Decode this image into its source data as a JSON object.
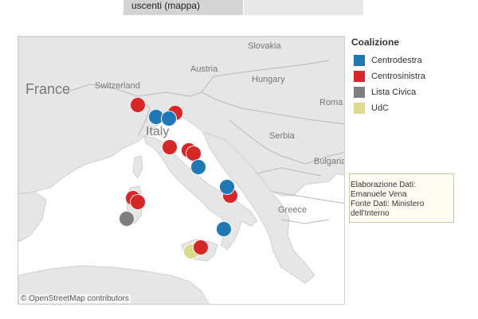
{
  "tabs": [
    {
      "label": "uscenti (mappa)",
      "active": true
    },
    {
      "label": "",
      "active": false
    }
  ],
  "map": {
    "place_labels": {
      "france": "France",
      "switzerland": "Switzerland",
      "austria": "Austria",
      "slovakia": "Slovakia",
      "hungary": "Hungary",
      "roma": "Roma",
      "italy": "Italy",
      "serbia": "Serbia",
      "bulgaria": "Bulgaria",
      "greece": "Greece"
    },
    "attribution": "© OpenStreetMap contributors",
    "markers": [
      {
        "coalition": "Centrosinistra",
        "color": "#d62728"
      },
      {
        "coalition": "Centrosinistra",
        "color": "#d62728"
      },
      {
        "coalition": "Centrodestra",
        "color": "#1f77b4"
      },
      {
        "coalition": "Centrodestra",
        "color": "#1f77b4"
      },
      {
        "coalition": "Centrosinistra",
        "color": "#d62728"
      },
      {
        "coalition": "Centrosinistra",
        "color": "#d62728"
      },
      {
        "coalition": "Centrosinistra",
        "color": "#d62728"
      },
      {
        "coalition": "Centrodestra",
        "color": "#1f77b4"
      },
      {
        "coalition": "Centrosinistra",
        "color": "#d62728"
      },
      {
        "coalition": "Centrodestra",
        "color": "#1f77b4"
      },
      {
        "coalition": "Centrosinistra",
        "color": "#d62728"
      },
      {
        "coalition": "Centrosinistra",
        "color": "#d62728"
      },
      {
        "coalition": "Lista Civica",
        "color": "#7f7f7f"
      },
      {
        "coalition": "Centrodestra",
        "color": "#1f77b4"
      },
      {
        "coalition": "UdC",
        "color": "#dbdb8d"
      },
      {
        "coalition": "Centrosinistra",
        "color": "#d62728"
      }
    ]
  },
  "legend": {
    "title": "Coalizione",
    "items": [
      {
        "label": "Centrodestra",
        "color": "#1f77b4"
      },
      {
        "label": "Centrosinistra",
        "color": "#d62728"
      },
      {
        "label": "Lista Civica",
        "color": "#7f7f7f"
      },
      {
        "label": "UdC",
        "color": "#dbdb8d"
      }
    ]
  },
  "note": {
    "line1": "Elaborazione Dati:",
    "line2": "Emanuele Vena",
    "line3": "Fonte Dati: Ministero",
    "line4": "dell'Interno"
  }
}
